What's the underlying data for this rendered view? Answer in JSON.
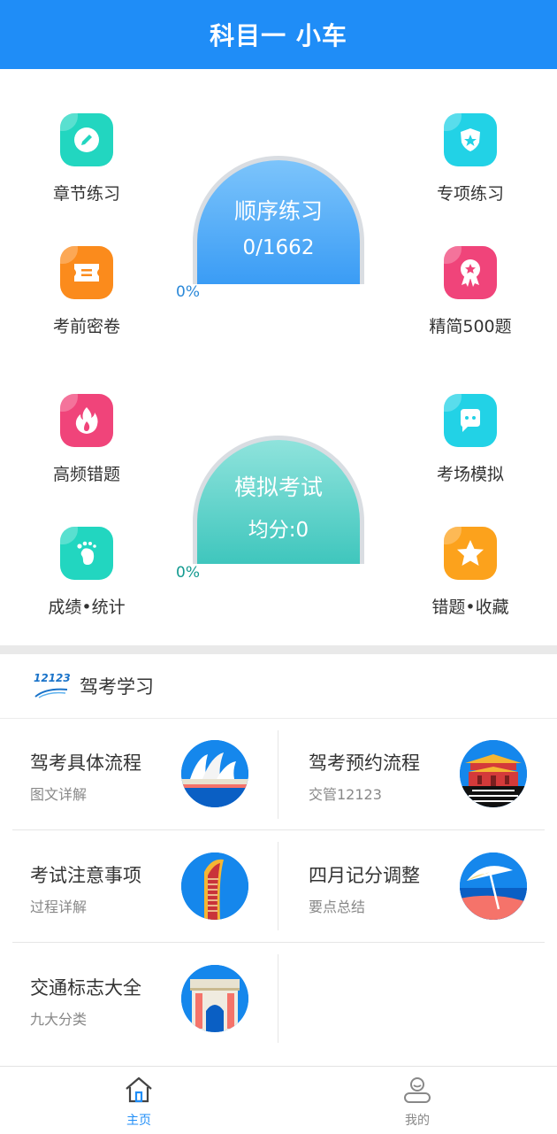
{
  "header": {
    "title": "科目一 小车"
  },
  "colors": {
    "primary": "#1f8df7",
    "teal": "#3fcfc3",
    "orange": "#fb8b1c",
    "pink": "#f0447a",
    "cyan": "#22d2e6"
  },
  "practice": {
    "dome_title": "顺序练习",
    "dome_value": "0/1662",
    "percent": "0%",
    "items": {
      "chapter": "章节练习",
      "special": "专项练习",
      "secret": "考前密卷",
      "simplified": "精简500题"
    }
  },
  "exam": {
    "dome_title": "模拟考试",
    "dome_value": "均分:0",
    "percent": "0%",
    "items": {
      "frequent_errors": "高频错题",
      "venue_sim": "考场模拟",
      "scores": "成绩•统计",
      "wrong_favs": "错题•收藏"
    }
  },
  "study": {
    "logo_text": "12123",
    "title": "驾考学习",
    "cards": [
      {
        "title": "驾考具体流程",
        "subtitle": "图文详解",
        "icon": "opera-house-icon"
      },
      {
        "title": "驾考预约流程",
        "subtitle": "交管12123",
        "icon": "palace-gate-icon"
      },
      {
        "title": "考试注意事项",
        "subtitle": "过程详解",
        "icon": "tower-building-icon"
      },
      {
        "title": "四月记分调整",
        "subtitle": "要点总结",
        "icon": "beach-umbrella-icon"
      },
      {
        "title": "交通标志大全",
        "subtitle": "九大分类",
        "icon": "triumphal-arch-icon"
      }
    ]
  },
  "tabs": {
    "home": "主页",
    "mine": "我的",
    "home_icon": "home-icon",
    "mine_icon": "user-icon"
  }
}
